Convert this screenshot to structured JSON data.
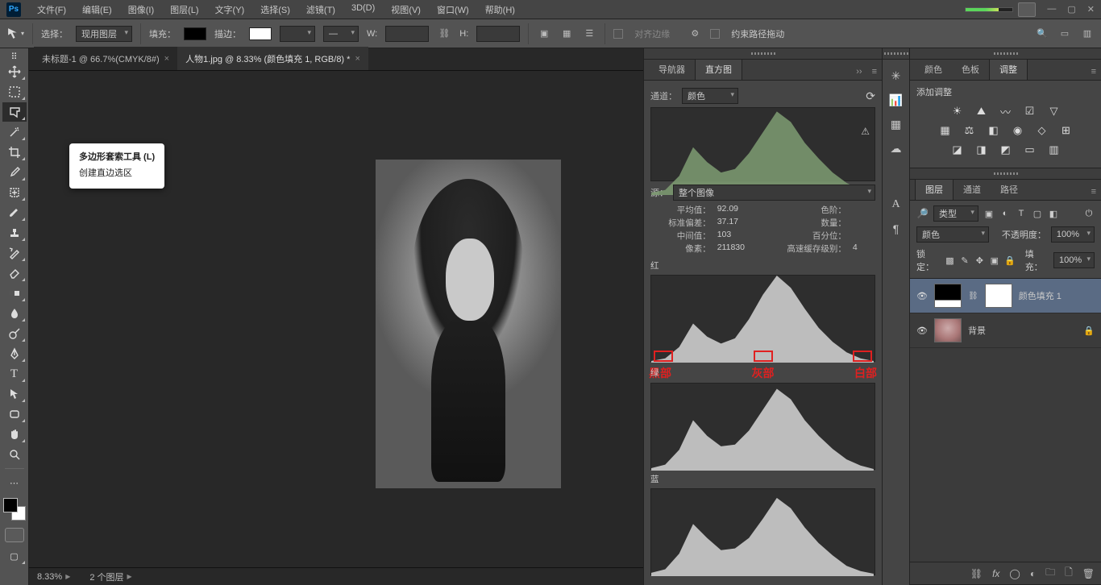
{
  "menu": [
    "文件(F)",
    "编辑(E)",
    "图像(I)",
    "图层(L)",
    "文字(Y)",
    "选择(S)",
    "滤镜(T)",
    "3D(D)",
    "视图(V)",
    "窗口(W)",
    "帮助(H)"
  ],
  "options": {
    "select_label": "选择：",
    "select_value": "现用图层",
    "fill_label": "填充：",
    "stroke_label": "描边：",
    "w_label": "W:",
    "h_label": "H:",
    "align_label": "对齐边缘",
    "constrain_label": "约束路径拖动"
  },
  "tooltip": {
    "title": "多边形套索工具 (L)",
    "subtitle": "创建直边选区"
  },
  "tabs": [
    {
      "label": "未标题-1 @ 66.7%(CMYK/8#)",
      "active": false
    },
    {
      "label": "人物1.jpg @ 8.33% (颜色填充 1, RGB/8) *",
      "active": true
    }
  ],
  "status": {
    "zoom": "8.33%",
    "layers": "2 个图层"
  },
  "nav_panel": {
    "tab1": "导航器",
    "tab2": "直方图"
  },
  "hist": {
    "channel_label": "通道：",
    "channel_value": "颜色",
    "source_label": "源：",
    "source_value": "整个图像",
    "mean_k": "平均值：",
    "mean_v": "92.09",
    "std_k": "标准偏差：",
    "std_v": "37.17",
    "med_k": "中间值：",
    "med_v": "103",
    "pix_k": "像素：",
    "pix_v": "211830",
    "lvl_k": "色阶：",
    "lvl_v": "",
    "cnt_k": "数量：",
    "cnt_v": "",
    "pct_k": "百分位：",
    "pct_v": "",
    "cache_k": "高速缓存级别：",
    "cache_v": "4",
    "red": "红",
    "green": "绿",
    "blue": "蓝"
  },
  "annot": {
    "black": "黑部",
    "gray": "灰部",
    "white": "白部"
  },
  "right_tabs": {
    "color": "颜色",
    "swatches": "色板",
    "adjust": "调整"
  },
  "adjust": {
    "title": "添加调整"
  },
  "layer_panel": {
    "tab_layers": "图层",
    "tab_channels": "通道",
    "tab_paths": "路径",
    "kind_label": "类型",
    "blend_value": "颜色",
    "opacity_label": "不透明度：",
    "opacity_value": "100%",
    "lock_label": "锁定：",
    "fill_label": "填充：",
    "fill_value": "100%",
    "layer1": "颜色填充 1",
    "layer2": "背景"
  },
  "chart_data": [
    {
      "type": "area",
      "name": "color-overall",
      "color": "#7e9c72",
      "x": [
        0,
        16,
        32,
        48,
        64,
        80,
        96,
        112,
        128,
        144,
        160,
        176,
        192,
        208,
        224,
        240,
        255
      ],
      "y": [
        3,
        6,
        22,
        55,
        38,
        26,
        30,
        48,
        72,
        96,
        84,
        60,
        42,
        26,
        14,
        6,
        2
      ],
      "xlim": [
        0,
        255
      ],
      "ylim": [
        0,
        100
      ]
    },
    {
      "type": "area",
      "name": "red",
      "color": "#d6d6d6",
      "x": [
        0,
        16,
        32,
        48,
        64,
        80,
        96,
        112,
        128,
        144,
        160,
        176,
        192,
        208,
        224,
        240,
        255
      ],
      "y": [
        2,
        5,
        18,
        45,
        30,
        22,
        28,
        50,
        78,
        100,
        86,
        62,
        40,
        24,
        12,
        5,
        2
      ],
      "xlim": [
        0,
        255
      ],
      "ylim": [
        0,
        100
      ]
    },
    {
      "type": "area",
      "name": "green",
      "color": "#d6d6d6",
      "x": [
        0,
        16,
        32,
        48,
        64,
        80,
        96,
        112,
        128,
        144,
        160,
        176,
        192,
        208,
        224,
        240,
        255
      ],
      "y": [
        3,
        7,
        24,
        58,
        40,
        28,
        30,
        46,
        70,
        94,
        82,
        58,
        40,
        25,
        13,
        6,
        2
      ],
      "xlim": [
        0,
        255
      ],
      "ylim": [
        0,
        100
      ]
    },
    {
      "type": "area",
      "name": "blue",
      "color": "#d6d6d6",
      "x": [
        0,
        16,
        32,
        48,
        64,
        80,
        96,
        112,
        128,
        144,
        160,
        176,
        192,
        208,
        224,
        240,
        255
      ],
      "y": [
        4,
        8,
        26,
        60,
        44,
        30,
        32,
        44,
        66,
        90,
        78,
        56,
        38,
        24,
        12,
        6,
        3
      ],
      "xlim": [
        0,
        255
      ],
      "ylim": [
        0,
        100
      ]
    }
  ]
}
